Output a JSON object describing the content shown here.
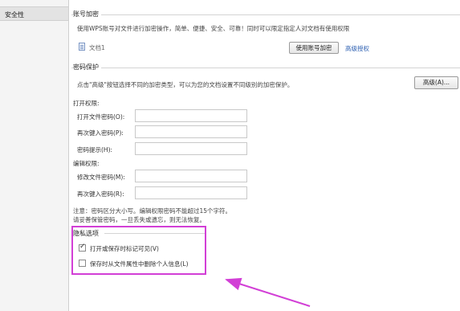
{
  "sidebar": {
    "items": [
      {
        "label": "安全性"
      }
    ]
  },
  "account_encryption": {
    "title": "账号加密",
    "description": "使用WPS账号对文件进行加密操作，简单、便捷、安全、可靠！同时可以限定指定人对文档有使用权限",
    "file_name": "文档1",
    "encrypt_button": "使用账号加密",
    "advanced_link": "高级授权"
  },
  "password_protection": {
    "title": "密码保护",
    "description": "点击\"高级\"按钮选择不同的加密类型，可以为您的文档设置不同级别的加密保护。",
    "advanced_button": "高级(A)...",
    "open_permission": {
      "title": "打开权限:",
      "fields": [
        {
          "label": "打开文件密码(O):",
          "value": ""
        },
        {
          "label": "再次键入密码(P):",
          "value": ""
        },
        {
          "label": "密码提示(H):",
          "value": ""
        }
      ]
    },
    "edit_permission": {
      "title": "编辑权限:",
      "fields": [
        {
          "label": "修改文件密码(M):",
          "value": ""
        },
        {
          "label": "再次键入密码(R):",
          "value": ""
        }
      ]
    },
    "note_line1": "注意：密码区分大小写。编辑权限密码不能超过15个字符。",
    "note_line2": "请妥善保管密码，一旦丢失或遗忘，则无法恢复。"
  },
  "privacy": {
    "title": "隐私选项",
    "options": [
      {
        "label": "打开或保存时标记可见(V)",
        "checked": true
      },
      {
        "label": "保存时从文件属性中删除个人信息(L)",
        "checked": false
      }
    ]
  },
  "colors": {
    "highlight": "#d23fd6",
    "link": "#2a5db0"
  }
}
